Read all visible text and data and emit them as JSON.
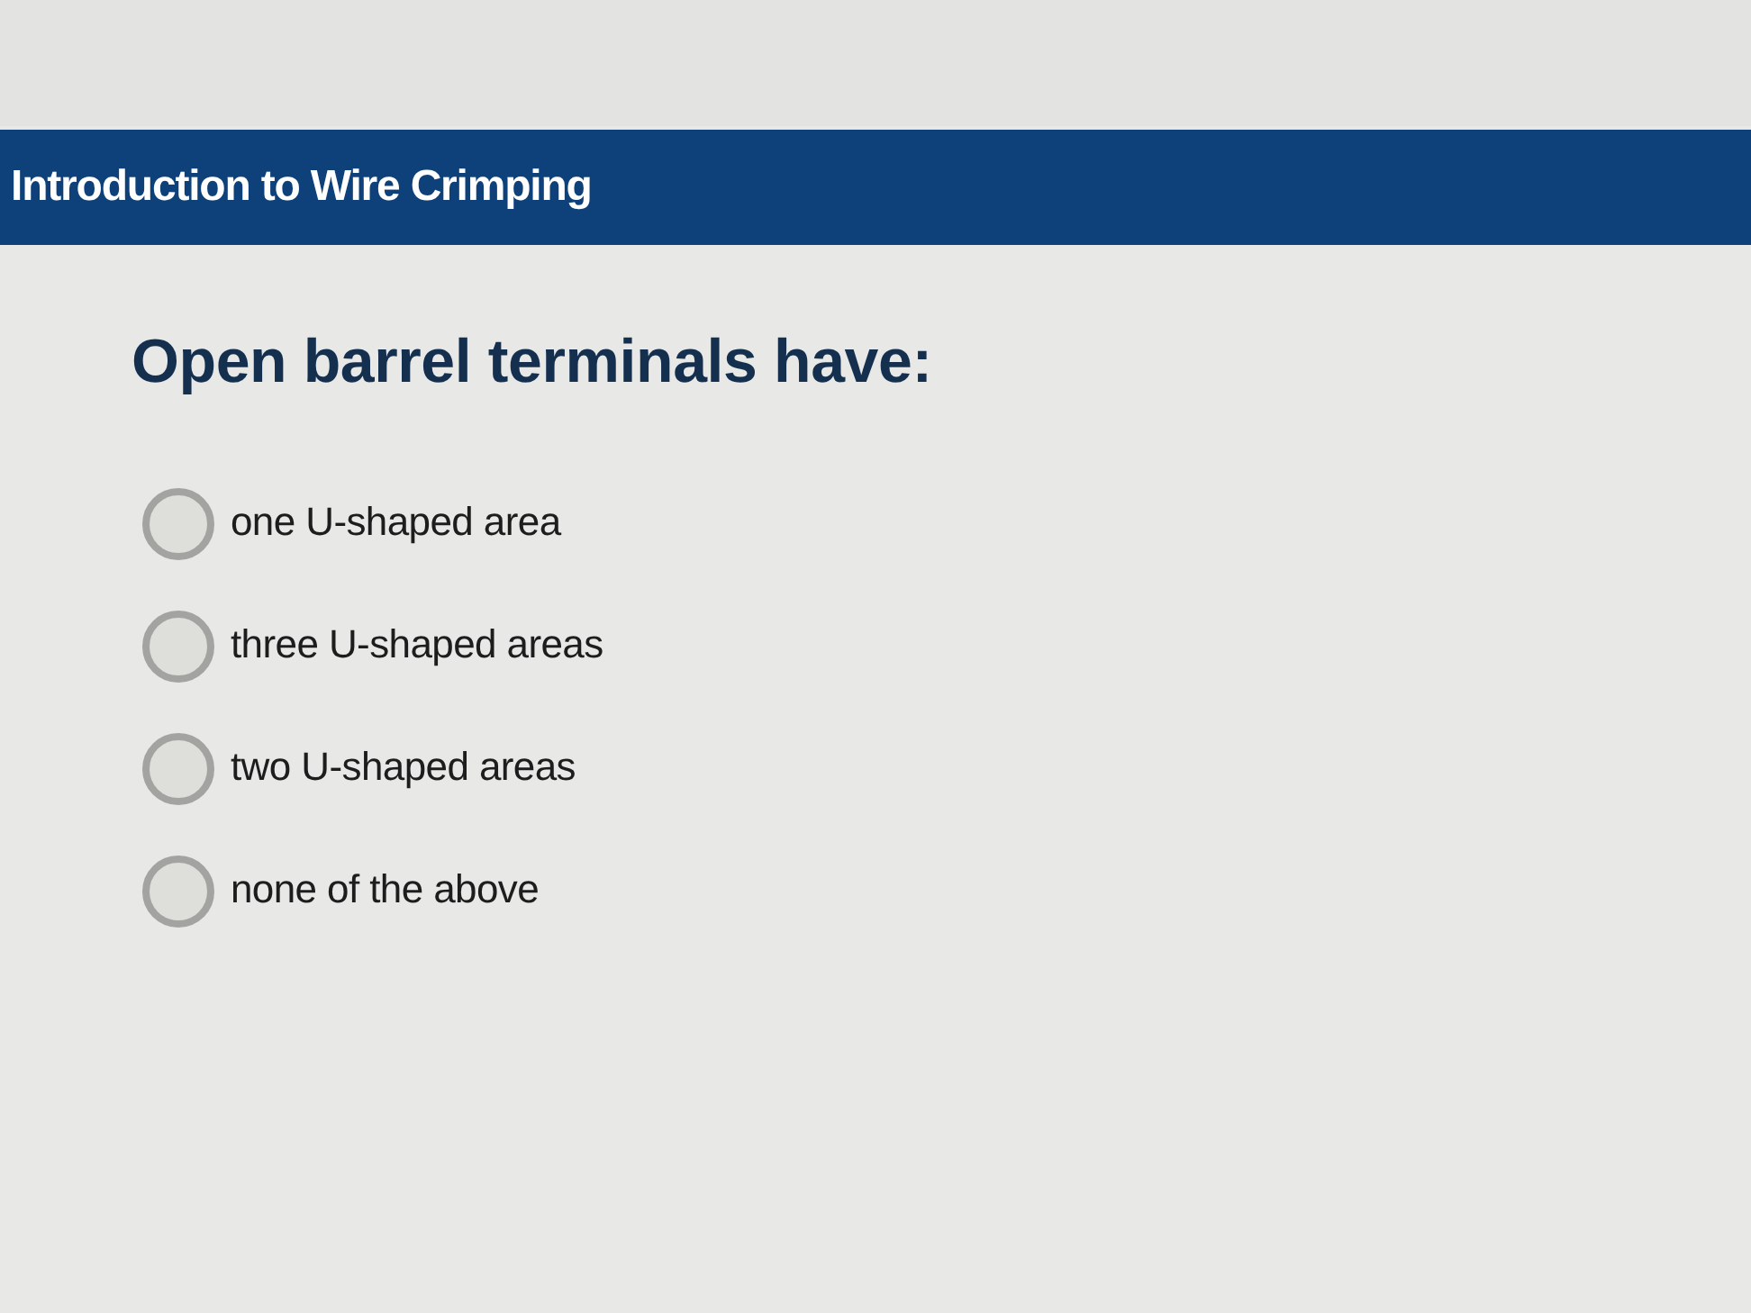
{
  "header": {
    "title": "Introduction to Wire Crimping"
  },
  "question": {
    "text": "Open barrel terminals have:",
    "options": [
      {
        "label": "one U-shaped area",
        "selected": false
      },
      {
        "label": "three U-shaped areas",
        "selected": false
      },
      {
        "label": "two U-shaped areas",
        "selected": false
      },
      {
        "label": "none of the above",
        "selected": false
      }
    ]
  }
}
